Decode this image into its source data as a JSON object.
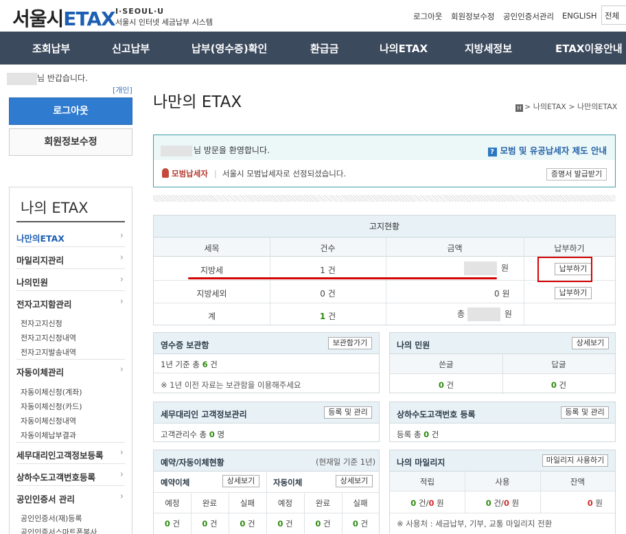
{
  "header": {
    "logo_kr": "서울시",
    "logo_en": "ETAX",
    "sub1": "I·SEOUL·U",
    "sub2": "서울시 인터넷 세금납부 시스템",
    "util_links": [
      "로그아웃",
      "회원정보수정",
      "공인인증서관리",
      "ENGLISH"
    ],
    "util_button": "전체"
  },
  "gnb": [
    "조회납부",
    "신고납부",
    "납부(영수증)확인",
    "환급금",
    "나의ETAX",
    "지방세정보",
    "ETAX이용안내"
  ],
  "sidebar": {
    "greeting": "님 반갑습니다.",
    "private_tag": "[개인]",
    "logout": "로그아웃",
    "edit_info": "회원정보수정",
    "title": "나의 ETAX",
    "items": [
      {
        "label": "나만의ETAX",
        "active": true
      },
      {
        "label": "마일리지관리"
      },
      {
        "label": "나의민원"
      },
      {
        "label": "전자고지함관리"
      },
      {
        "label": "자동이체관리"
      },
      {
        "label": "세무대리인고객정보등록"
      },
      {
        "label": "상하수도고객번호등록"
      },
      {
        "label": "공인인증서 관리"
      }
    ],
    "sub_e_notice": [
      "전자고지신청",
      "전자고지신청내역",
      "전자고지발송내역"
    ],
    "sub_auto": [
      "자동이체신청(계좌)",
      "자동이체신청(카드)",
      "자동이체신청내역",
      "자동이체납부결과"
    ],
    "sub_cert": [
      "공인인증서(재)등록",
      "공인인증서스마트폰복사"
    ]
  },
  "main": {
    "title": "나만의 ETAX",
    "breadcrumb": "> 나의ETAX > 나만의ETAX",
    "welcome": {
      "text": "님 방문을 환영합니다.",
      "guide": "모범 및 유공납세자 제도 안내",
      "model_label": "모범납세자",
      "model_desc": "서울시 모범납세자로 선정되셨습니다.",
      "cert_button": "증명서 발급받기"
    },
    "notice": {
      "title": "고지현황",
      "headers": [
        "세목",
        "건수",
        "금액",
        "납부하기"
      ],
      "rows": [
        {
          "item": "지방세",
          "count_num": "1",
          "count_unit": "건",
          "amount_unit": "원",
          "pay": "납부하기"
        },
        {
          "item": "지방세외",
          "count_num": "0",
          "count_unit": "건",
          "amount": "0",
          "amount_unit": "원",
          "pay": "납부하기"
        },
        {
          "item": "계",
          "count_num": "1",
          "count_unit": "건",
          "amount_prefix": "총",
          "amount_unit": "원"
        }
      ]
    },
    "receipt": {
      "title": "영수증 보관함",
      "button": "보관함가기",
      "line1_prefix": "1년 기준 총",
      "line1_num": "6",
      "line1_suffix": "건",
      "line2": "※ 1년 이전 자료는 보관함을 이용해주세요"
    },
    "petition": {
      "title": "나의 민원",
      "button": "상세보기",
      "col1": "쓴글",
      "col2": "답글",
      "val1": "0",
      "val2": "0",
      "unit": "건"
    },
    "agent": {
      "title": "세무대리인 고객정보관리",
      "button": "등록 및 관리",
      "text_prefix": "고객관리수 총",
      "num": "0",
      "text_suffix": "명"
    },
    "water": {
      "title": "상하수도고객번호 등록",
      "button": "등록 및 관리",
      "text_prefix": "등록 총",
      "num": "0",
      "text_suffix": "건"
    },
    "reserve": {
      "title": "예약/자동이체현황",
      "note": "(현재일 기준 1년)",
      "left_title": "예약이체",
      "right_title": "자동이체",
      "button": "상세보기",
      "cols": [
        "예정",
        "완료",
        "실패"
      ],
      "values": [
        "0",
        "0",
        "0",
        "0",
        "0",
        "0"
      ],
      "unit": "건"
    },
    "mileage": {
      "title": "나의 마일리지",
      "button": "마일리지 사용하기",
      "cols": [
        "적립",
        "사용",
        "잔액"
      ],
      "earn_cnt": "0",
      "earn_amt": "0",
      "use_cnt": "0",
      "use_amt": "0",
      "balance": "0",
      "cnt_unit": "건/",
      "amt_unit": "원",
      "note": "※ 사용처 : 세금납부, 기부, 교통 마일리지 전환"
    }
  }
}
